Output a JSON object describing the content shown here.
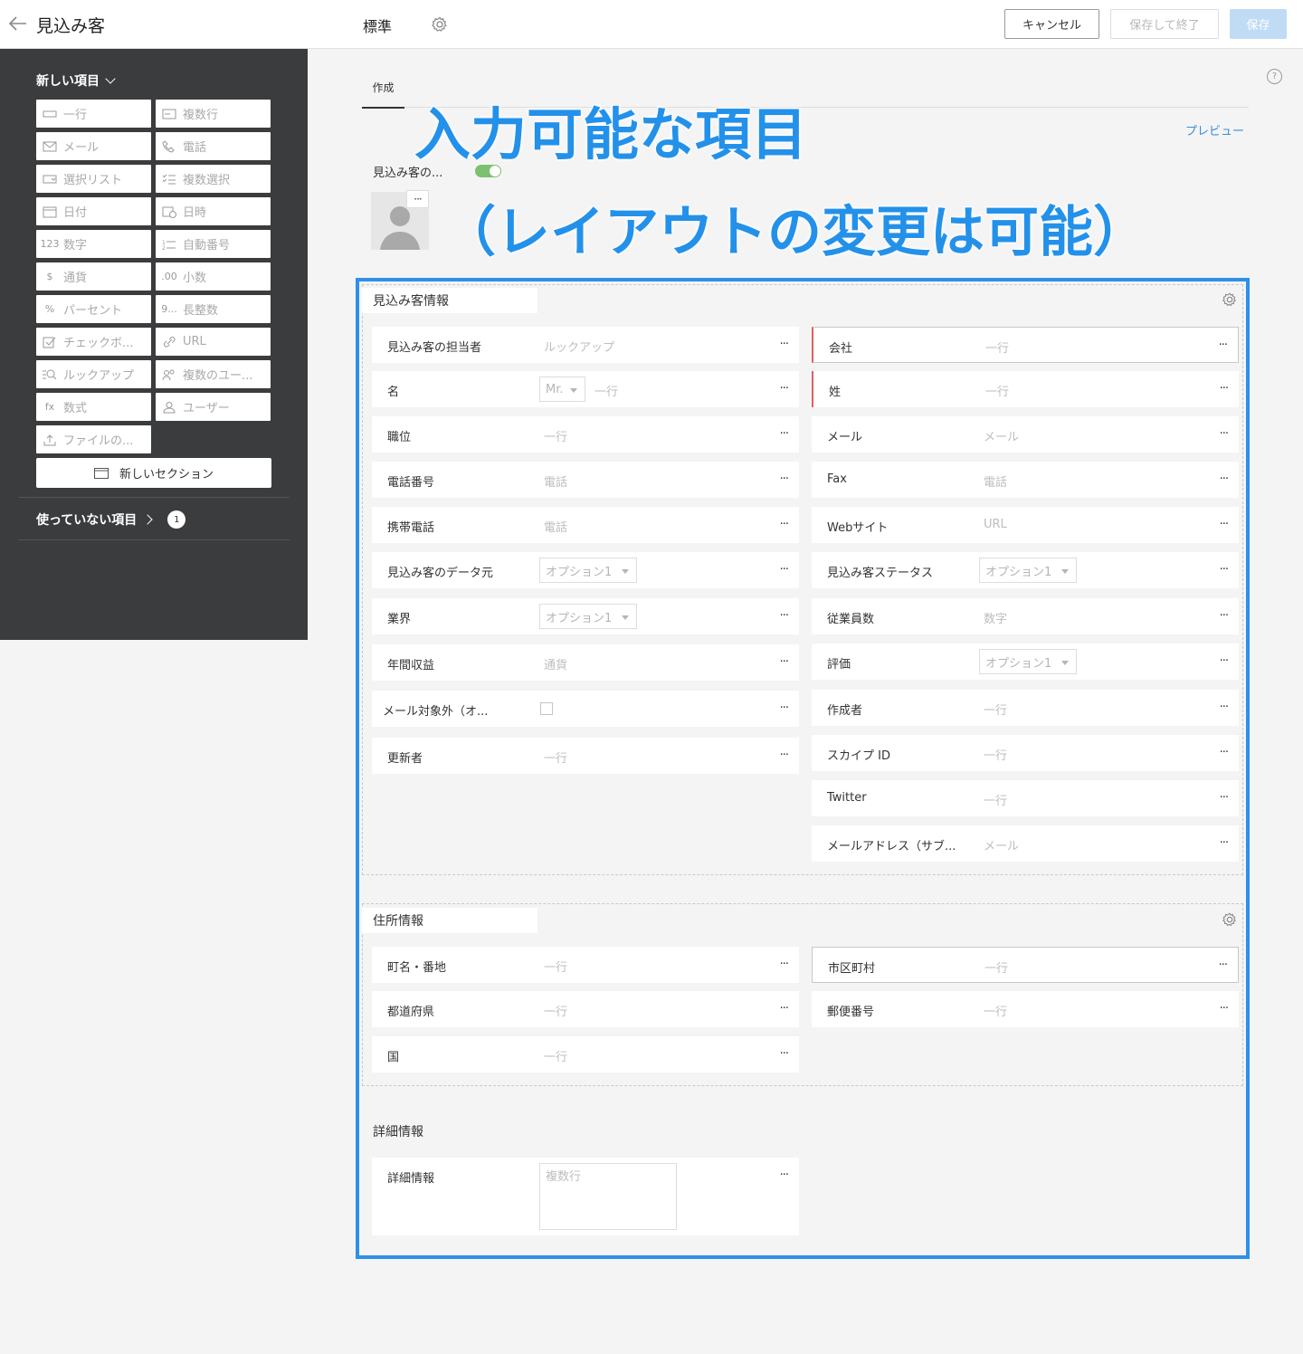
{
  "header": {
    "app_title": "見込み客",
    "layout_name": "標準",
    "cancel_label": "キャンセル",
    "save_close_label": "保存して終了",
    "save_label": "保存"
  },
  "sidebar": {
    "new_items_title": "新しい項目",
    "items": [
      {
        "label": "一行",
        "icon": "single-line-icon",
        "glyph": ""
      },
      {
        "label": "複数行",
        "icon": "multi-line-icon",
        "glyph": ""
      },
      {
        "label": "メール",
        "icon": "email-icon",
        "glyph": ""
      },
      {
        "label": "電話",
        "icon": "phone-icon",
        "glyph": ""
      },
      {
        "label": "選択リスト",
        "icon": "picklist-icon",
        "glyph": ""
      },
      {
        "label": "複数選択",
        "icon": "multiselect-icon",
        "glyph": ""
      },
      {
        "label": "日付",
        "icon": "date-icon",
        "glyph": ""
      },
      {
        "label": "日時",
        "icon": "datetime-icon",
        "glyph": ""
      },
      {
        "label": "数字",
        "icon": "number-icon",
        "glyph": "123"
      },
      {
        "label": "自動番号",
        "icon": "autonumber-icon",
        "glyph": ""
      },
      {
        "label": "通貨",
        "icon": "currency-icon",
        "glyph": "$"
      },
      {
        "label": "小数",
        "icon": "decimal-icon",
        "glyph": ".00"
      },
      {
        "label": "パーセント",
        "icon": "percent-icon",
        "glyph": "%"
      },
      {
        "label": "長整数",
        "icon": "long-integer-icon",
        "glyph": "9..."
      },
      {
        "label": "チェックボ...",
        "icon": "checkbox-icon",
        "glyph": ""
      },
      {
        "label": "URL",
        "icon": "link-icon",
        "glyph": ""
      },
      {
        "label": "ルックアップ",
        "icon": "lookup-icon",
        "glyph": ""
      },
      {
        "label": "複数のユー...",
        "icon": "multi-user-icon",
        "glyph": ""
      },
      {
        "label": "数式",
        "icon": "formula-icon",
        "glyph": "fx"
      },
      {
        "label": "ユーザー",
        "icon": "user-icon",
        "glyph": ""
      },
      {
        "label": "ファイルの...",
        "icon": "upload-icon",
        "glyph": ""
      }
    ],
    "new_section_label": "新しいセクション",
    "unused_title": "使っていない項目",
    "unused_count": "1"
  },
  "main": {
    "tab_create": "作成",
    "preview": "プレビュー",
    "help": "?",
    "toggle_label": "見込み客の...",
    "toggle_on": true,
    "avatar_menu": "···"
  },
  "overlay": {
    "line1": "入力可能な項目",
    "line2": "（レイアウトの変更は可能）",
    "color": "#2391ea"
  },
  "sections": [
    {
      "title": "見込み客情報",
      "left": [
        {
          "label": "見込み客の担当者",
          "type": "text",
          "placeholder": "ルックアップ"
        },
        {
          "label": "名",
          "type": "salutation",
          "select": "Mr.",
          "placeholder": "一行"
        },
        {
          "label": "職位",
          "type": "text",
          "placeholder": "一行"
        },
        {
          "label": "電話番号",
          "type": "text",
          "placeholder": "電話"
        },
        {
          "label": "携帯電話",
          "type": "text",
          "placeholder": "電話"
        },
        {
          "label": "見込み客のデータ元",
          "type": "select",
          "select": "オプション1"
        },
        {
          "label": "業界",
          "type": "select",
          "select": "オプション1"
        },
        {
          "label": "年間収益",
          "type": "text",
          "placeholder": "通貨"
        },
        {
          "label": "メール対象外（オ...",
          "type": "checkbox"
        },
        {
          "label": "更新者",
          "type": "text",
          "placeholder": "一行"
        }
      ],
      "right": [
        {
          "label": "会社",
          "type": "text",
          "placeholder": "一行",
          "mandatory": true,
          "selected": true
        },
        {
          "label": "姓",
          "type": "text",
          "placeholder": "一行",
          "mandatory": true
        },
        {
          "label": "メール",
          "type": "text",
          "placeholder": "メール"
        },
        {
          "label": "Fax",
          "type": "text",
          "placeholder": "電話"
        },
        {
          "label": "Webサイト",
          "type": "text",
          "placeholder": "URL"
        },
        {
          "label": "見込み客ステータス",
          "type": "select",
          "select": "オプション1"
        },
        {
          "label": "従業員数",
          "type": "text",
          "placeholder": "数字"
        },
        {
          "label": "評価",
          "type": "select",
          "select": "オプション1"
        },
        {
          "label": "作成者",
          "type": "text",
          "placeholder": "一行"
        },
        {
          "label": "スカイプ ID",
          "type": "text",
          "placeholder": "一行"
        },
        {
          "label": "Twitter",
          "type": "text",
          "placeholder": "一行"
        },
        {
          "label": "メールアドレス（サブ...",
          "type": "text",
          "placeholder": "メール"
        }
      ]
    },
    {
      "title": "住所情報",
      "left": [
        {
          "label": "町名・番地",
          "type": "text",
          "placeholder": "一行"
        },
        {
          "label": "都道府県",
          "type": "text",
          "placeholder": "一行"
        },
        {
          "label": "国",
          "type": "text",
          "placeholder": "一行"
        }
      ],
      "right": [
        {
          "label": "市区町村",
          "type": "text",
          "placeholder": "一行",
          "selected": true
        },
        {
          "label": "郵便番号",
          "type": "text",
          "placeholder": "一行"
        }
      ]
    },
    {
      "title": "詳細情報",
      "left": [
        {
          "label": "詳細情報",
          "type": "textarea",
          "placeholder": "複数行"
        }
      ],
      "right": []
    }
  ],
  "field_menu": "···"
}
